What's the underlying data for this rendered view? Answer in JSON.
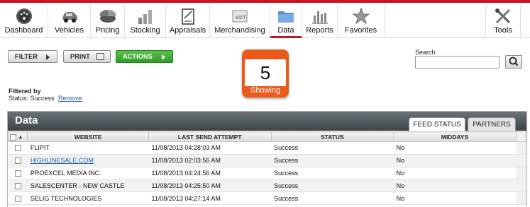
{
  "nav": [
    {
      "label": "Dashboard",
      "icon": "dashboard-gauge-icon"
    },
    {
      "label": "Vehicles",
      "icon": "car-icon"
    },
    {
      "label": "Pricing",
      "icon": "pie-chart-icon"
    },
    {
      "label": "Stocking",
      "icon": "bar-stack-icon"
    },
    {
      "label": "Appraisals",
      "icon": "clipboard-icon"
    },
    {
      "label": "Merchandising",
      "icon": "ebay-listing-icon"
    },
    {
      "label": "Data",
      "icon": "folder-icon"
    },
    {
      "label": "Reports",
      "icon": "report-chart-icon"
    },
    {
      "label": "Favorites",
      "icon": "star-icon"
    },
    {
      "label": "Tools",
      "icon": "tools-icon"
    }
  ],
  "toolbar": {
    "filter": "FILTER",
    "print": "PRINT",
    "actions": "ACTIONS"
  },
  "showing": {
    "count": "5",
    "label": "Showing"
  },
  "search": {
    "label": "Search",
    "value": ""
  },
  "filtered": {
    "heading": "Filtered by",
    "status": "Status: Success",
    "remove": "Remove"
  },
  "panel": {
    "title": "Data",
    "tabs": [
      "FEED STATUS",
      "PARTNERS"
    ],
    "columns": [
      "WEBSITE",
      "LAST SEND ATTEMPT",
      "STATUS",
      "MIDDAYS"
    ],
    "rows": [
      {
        "website": "FLIPIT",
        "last": "11/08/2013 04:28:03 AM",
        "status": "Success",
        "middays": "No"
      },
      {
        "website": "HIGHLINESALE.COM",
        "last": "11/08/2013 02:03:56 AM",
        "status": "Success",
        "middays": "No"
      },
      {
        "website": "PROEXCEL MEDIA INC.",
        "last": "11/08/2013 04:24:56 AM",
        "status": "Success",
        "middays": "No"
      },
      {
        "website": "SALESCENTER - NEW CASTLE",
        "last": "11/08/2013 04:25:50 AM",
        "status": "Success",
        "middays": "No"
      },
      {
        "website": "SELIG TECHNOLOGIES",
        "last": "11/08/2013 04:27:14 AM",
        "status": "Success",
        "middays": "No"
      }
    ]
  },
  "colors": {
    "brand_red": "#c8171e",
    "showing_orange": "#ea5a1a",
    "actions_green": "#3aa52f",
    "header_dark": "#4a5256"
  }
}
